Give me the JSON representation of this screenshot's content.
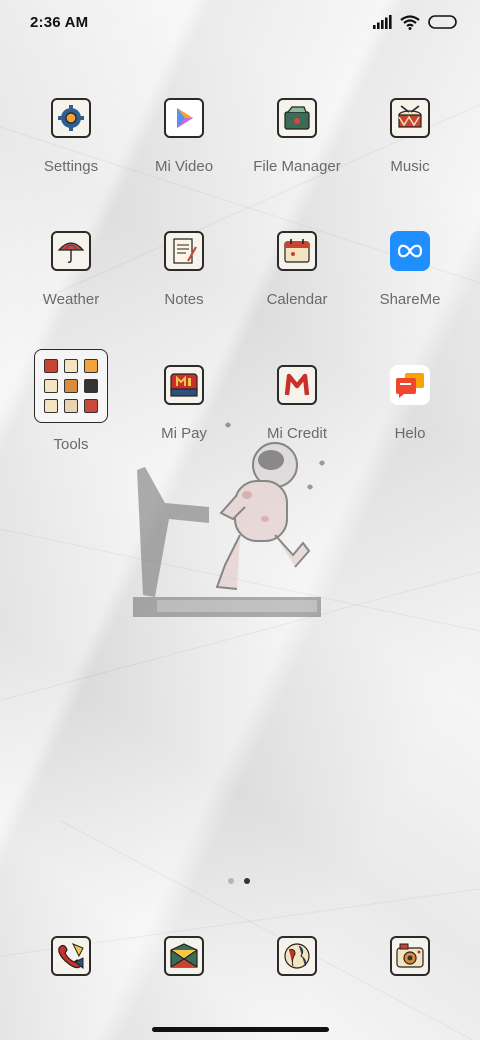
{
  "status_bar": {
    "time": "2:36 AM",
    "icons": [
      "signal-icon",
      "wifi-icon",
      "battery-icon"
    ]
  },
  "apps": [
    {
      "label": "Settings",
      "icon": "gear-icon"
    },
    {
      "label": "Mi Video",
      "icon": "play-icon"
    },
    {
      "label": "File Manager",
      "icon": "folder-icon"
    },
    {
      "label": "Music",
      "icon": "drum-icon"
    },
    {
      "label": "Weather",
      "icon": "umbrella-icon"
    },
    {
      "label": "Notes",
      "icon": "notepad-icon"
    },
    {
      "label": "Calendar",
      "icon": "calendar-icon"
    },
    {
      "label": "ShareMe",
      "icon": "infinity-icon"
    },
    {
      "label": "Tools",
      "icon": "folder-grid"
    },
    {
      "label": "Mi Pay",
      "icon": "mi-pay-icon"
    },
    {
      "label": "Mi Credit",
      "icon": "m-letter-icon"
    },
    {
      "label": "Helo",
      "icon": "chat-bubbles-icon"
    }
  ],
  "page_indicator": {
    "pages": 2,
    "active": 2
  },
  "dock": [
    {
      "name": "phone-icon"
    },
    {
      "name": "messages-icon"
    },
    {
      "name": "browser-icon"
    },
    {
      "name": "camera-icon"
    }
  ],
  "colors": {
    "label": "#6a6a6a",
    "dot_inactive": "#b5b5b5",
    "dot_active": "#333333",
    "icon_border": "#2b2b2b"
  }
}
